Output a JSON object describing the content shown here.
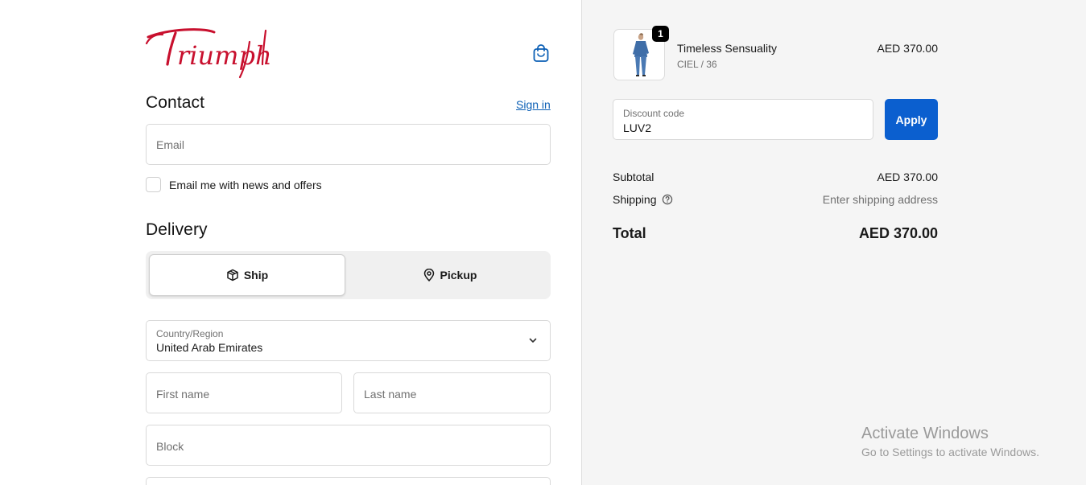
{
  "brand": {
    "name": "Triumph",
    "color": "#c8102e"
  },
  "header": {
    "cart_icon": "shopping-bag-icon"
  },
  "contact": {
    "title": "Contact",
    "signin_label": "Sign in",
    "email_placeholder": "Email",
    "newsletter_label": "Email me with news and offers",
    "newsletter_checked": false
  },
  "delivery": {
    "title": "Delivery",
    "options": [
      {
        "label": "Ship",
        "icon": "box-icon",
        "selected": true
      },
      {
        "label": "Pickup",
        "icon": "location-pin-icon",
        "selected": false
      }
    ],
    "country_label": "Country/Region",
    "country_value": "United Arab Emirates",
    "first_name_placeholder": "First name",
    "last_name_placeholder": "Last name",
    "block_placeholder": "Block"
  },
  "order": {
    "product": {
      "name": "Timeless Sensuality",
      "variant": "CIEL / 36",
      "price": "AED 370.00",
      "quantity": "1"
    },
    "discount": {
      "label": "Discount code",
      "value": "LUV2",
      "apply_label": "Apply"
    },
    "subtotal_label": "Subtotal",
    "subtotal_value": "AED 370.00",
    "shipping_label": "Shipping",
    "shipping_value": "Enter shipping address",
    "total_label": "Total",
    "total_value": "AED 370.00"
  },
  "watermark": {
    "title": "Activate Windows",
    "subtitle": "Go to Settings to activate Windows."
  },
  "colors": {
    "accent": "#0b5fcf",
    "link": "#0b5fb5",
    "sidebar_bg": "#f5f5f5"
  }
}
